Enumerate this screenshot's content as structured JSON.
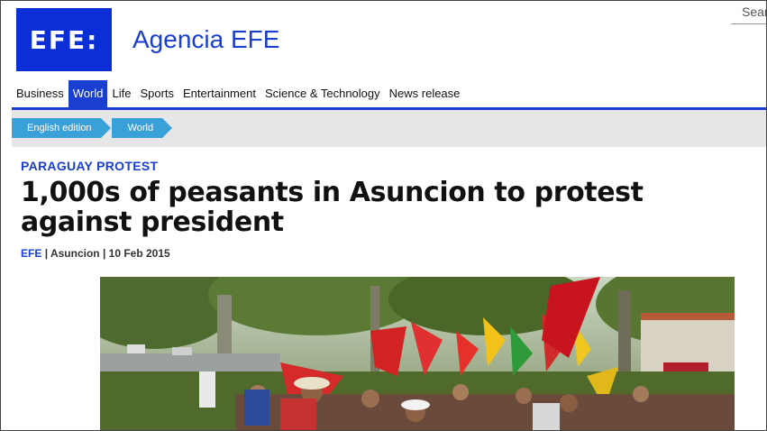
{
  "header": {
    "logo_text": "EFE:",
    "brand": "Agencia EFE",
    "search_placeholder": "Sear"
  },
  "nav": {
    "items": [
      {
        "label": "Business",
        "active": false
      },
      {
        "label": "World",
        "active": true
      },
      {
        "label": "Life",
        "active": false
      },
      {
        "label": "Sports",
        "active": false
      },
      {
        "label": "Entertainment",
        "active": false
      },
      {
        "label": "Science & Technology",
        "active": false
      },
      {
        "label": "News release",
        "active": false
      }
    ]
  },
  "breadcrumb": [
    "English edition",
    "World"
  ],
  "article": {
    "kicker": "PARAGUAY PROTEST",
    "headline": "1,000s of peasants in Asuncion to protest against president",
    "agency": "EFE",
    "location": "Asuncion",
    "date": "10 Feb 2015",
    "sep": "|"
  },
  "colors": {
    "brand_blue": "#1a3ecf",
    "breadcrumb_blue": "#3aa0d8",
    "band_gray": "#e6e6e6"
  }
}
